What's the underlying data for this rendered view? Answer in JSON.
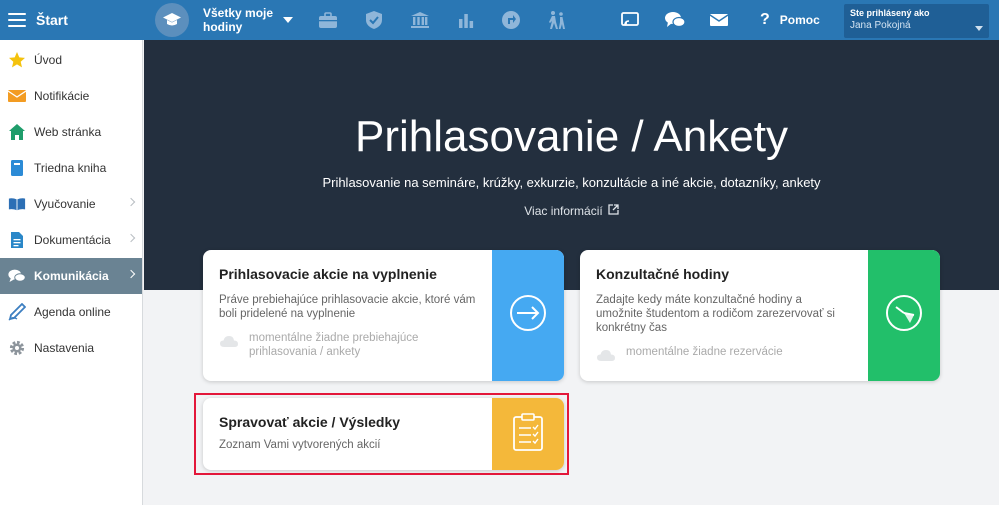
{
  "topbar": {
    "home_label": "Štart",
    "hours_label": "Všetky moje hodiny",
    "icons": [
      "graduation-cap-icon",
      "briefcase-icon",
      "shield-check-icon",
      "bank-icon",
      "bar-chart-icon",
      "signpost-icon",
      "walking-people-icon",
      "cast-icon",
      "chat-icon",
      "envelope-icon"
    ],
    "help_label": "Pomoc",
    "user_caption": "Ste prihlásený ako",
    "user_name": "Jana Pokojná",
    "color": "#2a77b4"
  },
  "sidebar": {
    "items": [
      {
        "label": "Úvod",
        "icon": "star-icon",
        "has_submenu": false,
        "active": false
      },
      {
        "label": "Notifikácie",
        "icon": "envelope-icon",
        "has_submenu": false,
        "active": false
      },
      {
        "label": "Web stránka",
        "icon": "house-icon",
        "has_submenu": false,
        "active": false
      },
      {
        "label": "Triedna kniha",
        "icon": "notebook-icon",
        "has_submenu": false,
        "active": false
      },
      {
        "label": "Vyučovanie",
        "icon": "open-book-icon",
        "has_submenu": true,
        "active": false
      },
      {
        "label": "Dokumentácia",
        "icon": "document-icon",
        "has_submenu": true,
        "active": false
      },
      {
        "label": "Komunikácia",
        "icon": "chat-bubbles-icon",
        "has_submenu": true,
        "active": true
      },
      {
        "label": "Agenda online",
        "icon": "pen-icon",
        "has_submenu": false,
        "active": false
      },
      {
        "label": "Nastavenia",
        "icon": "gear-icon",
        "has_submenu": false,
        "active": false
      }
    ],
    "active_color": "#6a8393"
  },
  "hero": {
    "title": "Prihlasovanie / Ankety",
    "subtitle": "Prihlasovanie na semináre, krúžky, exkurzie, konzultácie a iné akcie, dotazníky, ankety",
    "more_link": "Viac informácií",
    "background": "#232f3e"
  },
  "cards": [
    {
      "title": "Prihlasovacie akcie na vyplnenie",
      "description": "Práve prebiehajúce prihlasovacie akcie, ktoré vám boli pridelené na vyplnenie",
      "empty_text": "momentálne žiadne prebiehajúce prihlasovania / ankety",
      "icon": "arrow-circle-icon",
      "accent": "#45a9f2"
    },
    {
      "title": "Konzultačné hodiny",
      "description": "Zadajte kedy máte konzultačné hodiny a umožnite študentom a rodičom zarezervovať si konkrétny čas",
      "empty_text": "momentálne žiadne rezervácie",
      "icon": "clock-icon",
      "accent": "#22bf6a"
    },
    {
      "title": "Spravovať akcie / Výsledky",
      "description": "Zoznam Vami vytvorených akcií",
      "icon": "clipboard-check-icon",
      "accent": "#f4b83a"
    }
  ],
  "highlight_color": "#e3173a"
}
